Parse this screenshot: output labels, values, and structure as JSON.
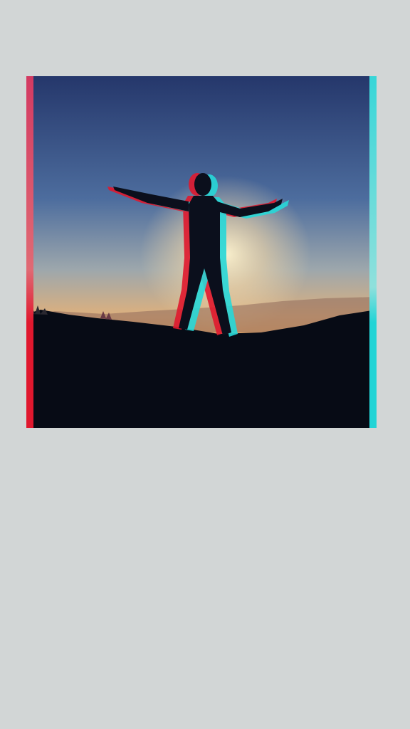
{
  "screen": {
    "background": "#d2d6d6"
  },
  "photo": {
    "description_icon": "glitch-photo",
    "colors": {
      "sky_top": "#27386a",
      "sky_mid": "#5a79a6",
      "sky_horizon": "#e1b07c",
      "sun_glow": "#fff2c9",
      "ground": "#070b15",
      "glitch_red": "#e0182e",
      "glitch_cyan": "#27d8d8"
    }
  }
}
